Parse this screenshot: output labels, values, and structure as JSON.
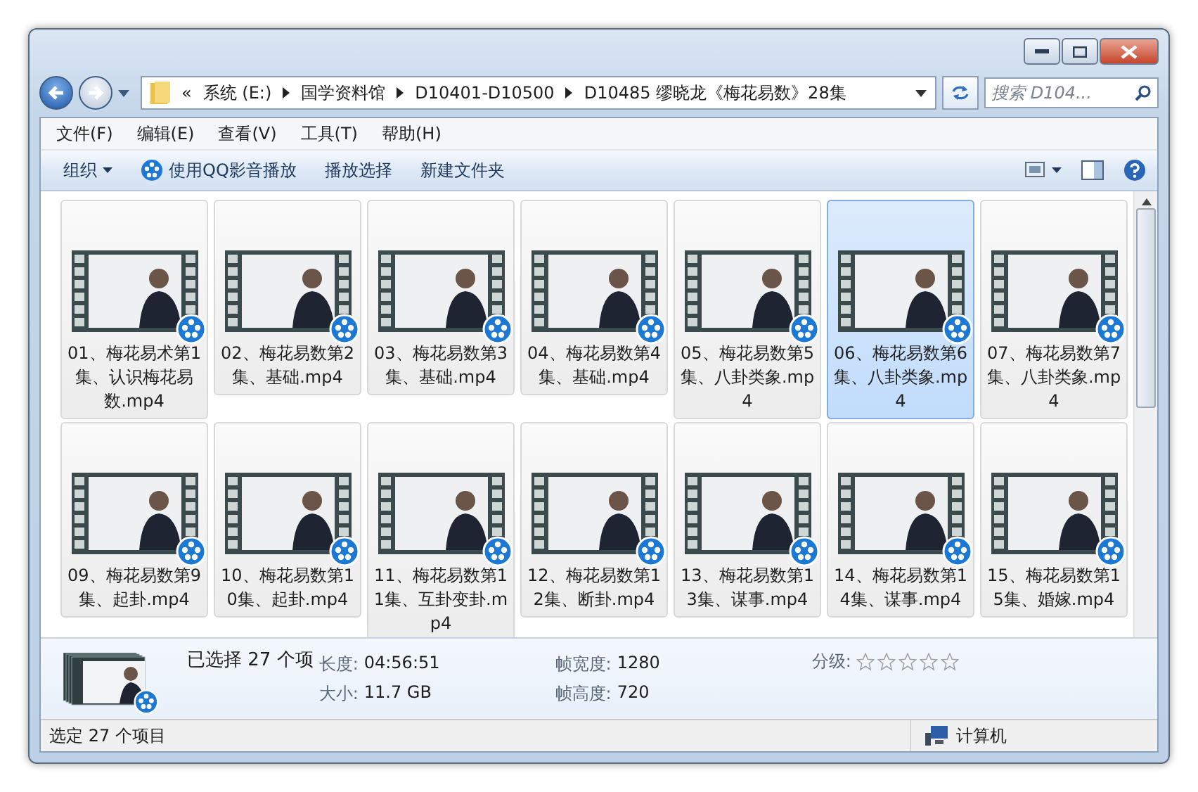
{
  "address": {
    "overflow": "«",
    "segments": [
      "系统 (E:)",
      "国学资料馆",
      "D10401-D10500",
      "D10485 缪晓龙《梅花易数》28集"
    ]
  },
  "search": {
    "placeholder": "搜索 D104..."
  },
  "menu": [
    "文件(F)",
    "编辑(E)",
    "查看(V)",
    "工具(T)",
    "帮助(H)"
  ],
  "toolbar": [
    {
      "label": "组织",
      "kind": "dropdown"
    },
    {
      "label": "使用QQ影音播放",
      "kind": "icon"
    },
    {
      "label": "播放选择",
      "kind": "plain"
    },
    {
      "label": "新建文件夹",
      "kind": "plain"
    }
  ],
  "files": [
    {
      "name": "01、梅花易术第1集、认识梅花易数.mp4",
      "selected": false
    },
    {
      "name": "02、梅花易数第2集、基础.mp4",
      "selected": false
    },
    {
      "name": "03、梅花易数第3集、基础.mp4",
      "selected": false
    },
    {
      "name": "04、梅花易数第4集、基础.mp4",
      "selected": false
    },
    {
      "name": "05、梅花易数第5集、八卦类象.mp4",
      "selected": false
    },
    {
      "name": "06、梅花易数第6集、八卦类象.mp4",
      "selected": true
    },
    {
      "name": "07、梅花易数第7集、八卦类象.mp4",
      "selected": false
    },
    {
      "name": "09、梅花易数第9集、起卦.mp4",
      "selected": false
    },
    {
      "name": "10、梅花易数第10集、起卦.mp4",
      "selected": false
    },
    {
      "name": "11、梅花易数第11集、互卦变卦.mp4",
      "selected": false
    },
    {
      "name": "12、梅花易数第12集、断卦.mp4",
      "selected": false
    },
    {
      "name": "13、梅花易数第13集、谋事.mp4",
      "selected": false
    },
    {
      "name": "14、梅花易数第14集、谋事.mp4",
      "selected": false
    },
    {
      "name": "15、梅花易数第15集、婚嫁.mp4",
      "selected": false
    }
  ],
  "details": {
    "summary": "已选择 27 个项",
    "fields": [
      {
        "label": "长度:",
        "value": "04:56:51"
      },
      {
        "label": "大小:",
        "value": "11.7 GB"
      },
      {
        "label": "帧宽度:",
        "value": "1280"
      },
      {
        "label": "帧高度:",
        "value": "720"
      }
    ],
    "rating": {
      "label": "分级:",
      "stars": 0
    }
  },
  "status": {
    "text": "选定 27 个项目",
    "location": "计算机"
  }
}
